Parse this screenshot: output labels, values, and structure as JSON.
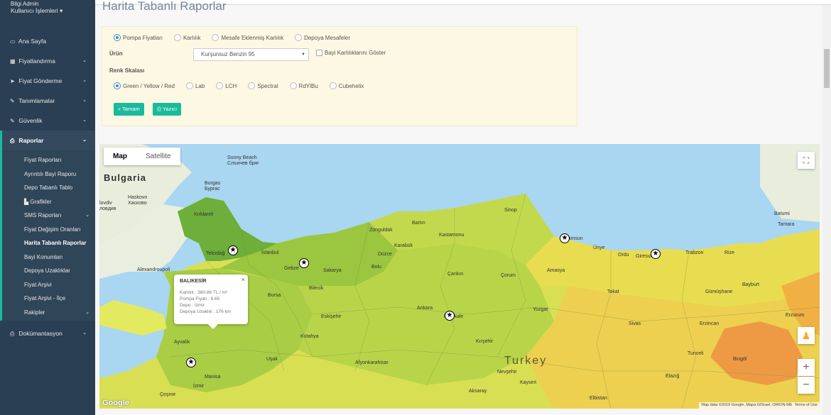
{
  "sidebar": {
    "user_name": "Bilgi Admin",
    "user_menu": "Kullanıcı İşlemleri",
    "items": [
      {
        "label": "Ana Sayfa",
        "icon": "laptop-icon",
        "glyph": "▭"
      },
      {
        "label": "Fiyatlandırma",
        "icon": "table-icon",
        "glyph": "▦"
      },
      {
        "label": "Fiyat Gönderme",
        "icon": "send-icon",
        "glyph": "➤"
      },
      {
        "label": "Tanımlamalar",
        "icon": "pencil-icon",
        "glyph": "✎"
      },
      {
        "label": "Güvenlik",
        "icon": "pencil-icon",
        "glyph": "✎"
      },
      {
        "label": "Raporlar",
        "icon": "print-icon",
        "glyph": "⎙"
      }
    ],
    "reports_sub": [
      "Fiyat Raporları",
      "Ayrıntılı Bayi Raporu",
      "Depo Tabanlı Tablo",
      "Grafikler",
      "SMS Raporları",
      "Fiyat Değişim Oranları",
      "Harita Tabanlı Raporlar",
      "Bayi Konumları",
      "Depoya Uzaklıklar",
      "Fiyat Arşivi",
      "Fiyat Arşivi - İlçe",
      "Rakipler"
    ],
    "docs": {
      "label": "Dokümantasyon",
      "icon": "print-icon",
      "glyph": "⎙"
    }
  },
  "page": {
    "title": "Harita Tabanlı Raporlar"
  },
  "filters": {
    "report_types": [
      "Pompa Fiyatları",
      "Karlılık",
      "Mesafe Eklenmiş Karlılık",
      "Depoya Mesafeler"
    ],
    "selected_report_type": "Pompa Fiyatları",
    "product_label": "Ürün",
    "product_value": "Kurşunsuz Benzin 95",
    "checkbox_label": "Bayi Karlılıklarını Göster",
    "color_scale_label": "Renk Skalası",
    "color_scales": [
      "Green / Yellow / Red",
      "Lab",
      "LCH",
      "Spectral",
      "RdYlBu",
      "Cubehelix"
    ],
    "selected_color_scale": "Green / Yellow / Red",
    "ok_button": "Tamam",
    "print_button": "Yazıcı"
  },
  "map": {
    "type_map": "Map",
    "type_satellite": "Satellite",
    "country_labels": [
      "Bulgaria",
      "Turkey"
    ],
    "city_labels": [
      "Sunny Beach",
      "Слънчев бряг",
      "Burgas",
      "Бургас",
      "Haskovo",
      "Хасково",
      "lovdiv",
      "ловдив",
      "Kırklareli",
      "Tekirdağ",
      "İstanbul",
      "Zonguldak",
      "Kastamonu",
      "Samsun",
      "Ünye",
      "Ordu",
      "Giresun",
      "Trabzon",
      "Rize",
      "Batumi",
      "Bursa",
      "Eskişehir",
      "Ankara",
      "Kırıkkale",
      "Kütahya",
      "Manisa",
      "İzmir",
      "Ayvalık",
      "Çeşme",
      "Kayseri",
      "Aksaray",
      "Elbistan",
      "Elazığ",
      "Erzurum",
      "Erzincan",
      "Tunceli",
      "Bingöl",
      "Alexandroupoli",
      "Gebze",
      "Sakarya",
      "Bolu",
      "Çankırı",
      "Çorum",
      "Karabük",
      "Bartın",
      "Sinop",
      "Amasya",
      "Tokat",
      "Sivas",
      "Yozgat",
      "Kırşehir",
      "Nevşehir",
      "Uşak",
      "Afyonkarahisar",
      "Bilecik",
      "Düzce",
      "Gümüşhane",
      "Bayburt",
      "Tamara"
    ],
    "info_window": {
      "title": "BALIKESİR",
      "karlilik": "Karlılık : 380.86 TL / m³",
      "pompa": "Pompa Fiyatı : 6.65",
      "depo": "Depo : İzmir",
      "uzaklik": "Depoya Uzaklık : 176 km"
    },
    "attribution": "Map data ©2019 Google, Mapa GISrael, ORION-ME",
    "terms": "Terms of Use",
    "google_logo": "Google",
    "zoom_in": "+",
    "zoom_out": "−"
  }
}
